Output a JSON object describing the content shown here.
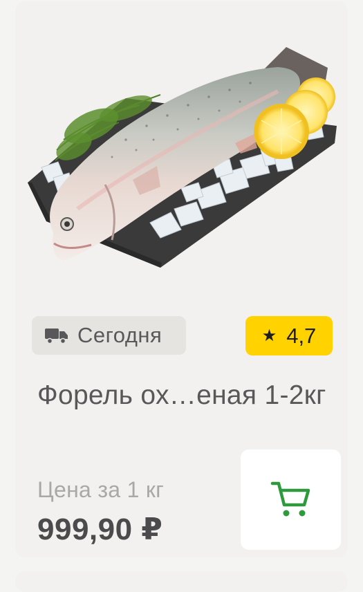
{
  "product": {
    "image_icon": "trout-fish-image",
    "delivery_icon": "truck-icon",
    "delivery_label": "Сегодня",
    "rating_icon": "star-icon",
    "rating_value": "4,7",
    "title": "Форель ох…еная 1-2кг",
    "price_label": "Цена за 1 кг",
    "price": "999,90 ₽",
    "cart_icon": "shopping-cart-icon"
  },
  "colors": {
    "rating_badge": "#ffd200",
    "cart_icon": "#2e9a3c",
    "delivery_badge": "#e5e4e1"
  }
}
